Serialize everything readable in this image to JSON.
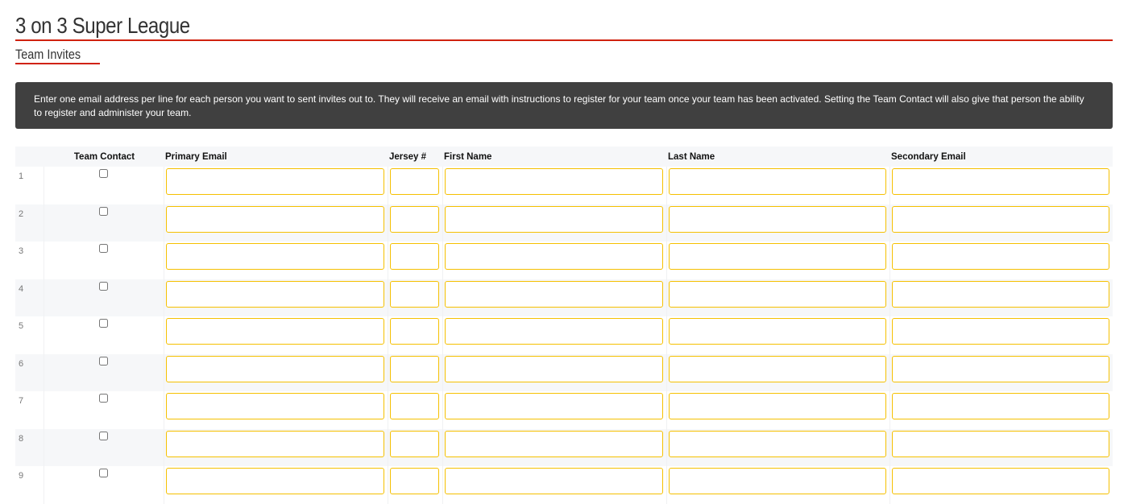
{
  "header": {
    "title": "3 on 3 Super League",
    "subtitle": "Team Invites"
  },
  "notice": "Enter one email address per line for each person you want to sent invites out to. They will receive an email with instructions to register for your team once your team has been activated. Setting the Team Contact will also give that person the ability to register and administer your team.",
  "table": {
    "columns": [
      "",
      "Team Contact",
      "Primary Email",
      "Jersey #",
      "First Name",
      "Last Name",
      "Secondary Email"
    ],
    "rows": [
      "1",
      "2",
      "3",
      "4",
      "5",
      "6",
      "7",
      "8",
      "9"
    ]
  },
  "colors": {
    "accent": "#d0220f",
    "input_border": "#f5c000",
    "notice_bg": "#404040"
  }
}
